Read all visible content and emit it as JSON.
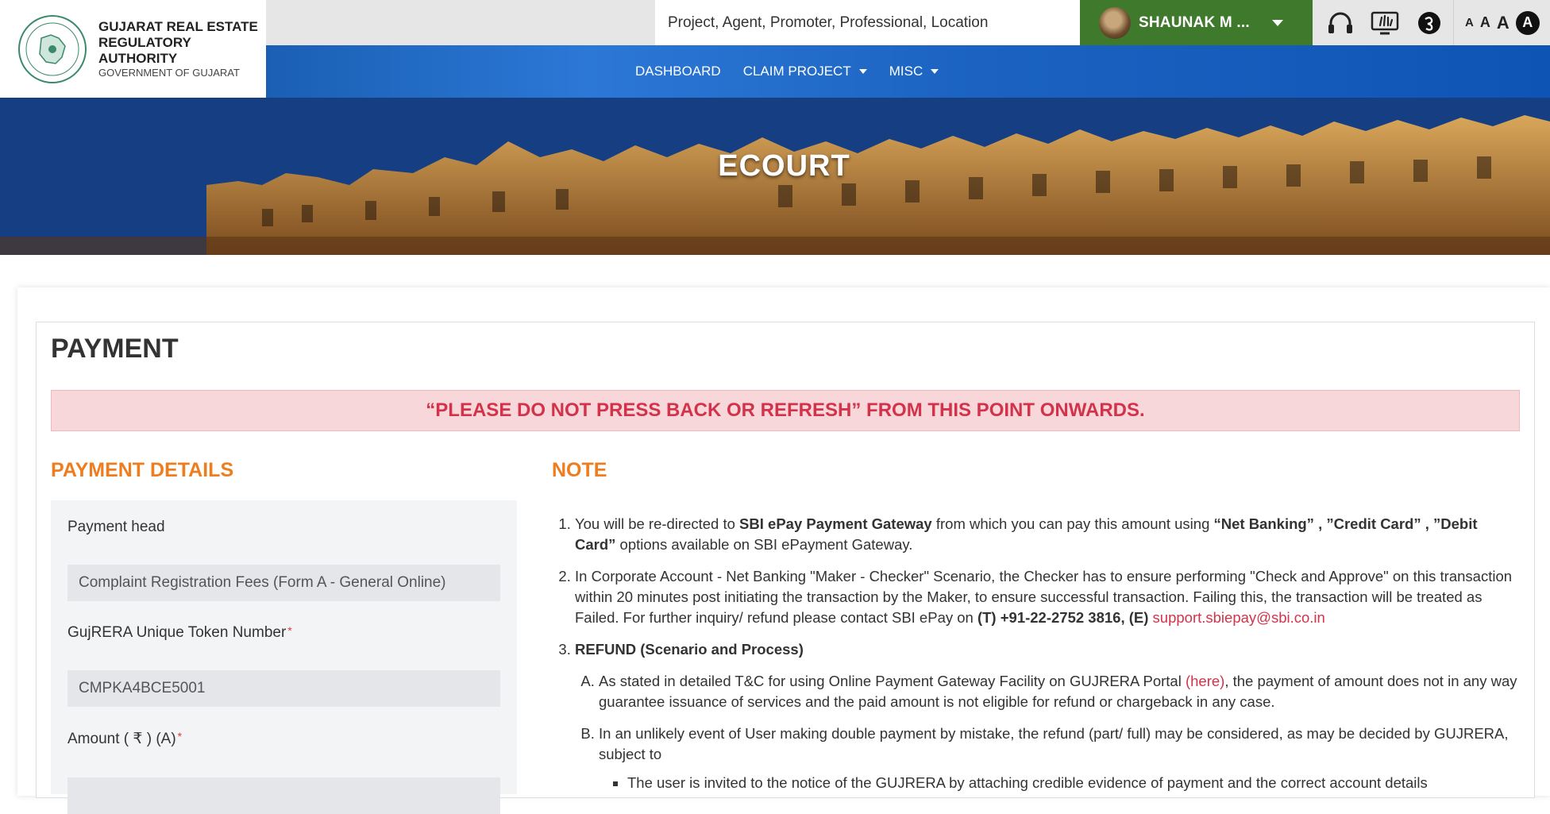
{
  "header": {
    "logo": {
      "line1": "GUJARAT REAL ESTATE",
      "line2": "REGULATORY AUTHORITY",
      "line3": "GOVERNMENT OF GUJARAT",
      "seal_text": "GUJARAT REAL ESTATE REGULATORY AUTHORITY"
    },
    "search": {
      "placeholder": "Project, Agent, Promoter, Professional, Location"
    },
    "user": {
      "name": "SHAUNAK M ..."
    },
    "utility_icons": [
      "headphones-icon",
      "sign-language-icon",
      "gujarati-language-icon"
    ],
    "font_sizes": {
      "small": "A",
      "medium": "A",
      "large": "A",
      "contrast": "A"
    }
  },
  "nav": {
    "dashboard": "DASHBOARD",
    "claim_project": "CLAIM PROJECT",
    "misc": "MISC"
  },
  "banner": {
    "title": "ECOURT"
  },
  "page": {
    "title": "PAYMENT",
    "warning": "“PLEASE DO NOT PRESS BACK OR REFRESH” FROM THIS POINT ONWARDS."
  },
  "payment_details": {
    "title": "PAYMENT DETAILS",
    "payment_head_label": "Payment head",
    "payment_head_value": "Complaint Registration Fees (Form A - General Online)",
    "token_label": "GujRERA Unique Token Number",
    "token_value": "CMPKA4BCE5001",
    "amount_label": "Amount ( ₹ ) (A)",
    "required_mark": "*"
  },
  "note": {
    "title": "NOTE",
    "item1": {
      "t1": "You will be re-directed to ",
      "b1": "SBI ePay Payment Gateway",
      "t2": " from which you can pay this amount using ",
      "b2": "“Net Banking” , ”Credit Card” , ”Debit Card”",
      "t3": " options available on SBI ePayment Gateway."
    },
    "item2": {
      "t1": "In Corporate Account - Net Banking \"Maker - Checker\" Scenario, the Checker has to ensure performing \"Check and Approve\" on this transaction within 20 minutes post initiating the transaction by the Maker, to ensure successful transaction. Failing this, the transaction will be treated as Failed. For further inquiry/ refund please contact SBI ePay on ",
      "b1": "(T) +91-22-2752 3816, (E) ",
      "link": "support.sbiepay@sbi.co.in"
    },
    "item3": {
      "title": "REFUND (Scenario and Process)",
      "a_t1": "As stated in detailed T&C for using Online Payment Gateway Facility on GUJRERA Portal ",
      "a_link": "(here)",
      "a_t2": ", the payment of amount does not in any way guarantee issuance of services and the paid amount is not eligible for refund or chargeback in any case.",
      "b_t1": "In an unlikely event of User making double payment by mistake, the refund (part/ full) may be considered, as may be decided by GUJRERA, subject to",
      "b_sub1": "The user is invited to the notice of the GUJRERA by attaching credible evidence of payment and the correct account details"
    }
  },
  "colors": {
    "accent_orange": "#ee7d1f",
    "alert_red": "#d3334a",
    "alert_bg": "#f8d7da",
    "nav_blue": "#1c63c1",
    "user_green": "#3f7a2c"
  }
}
